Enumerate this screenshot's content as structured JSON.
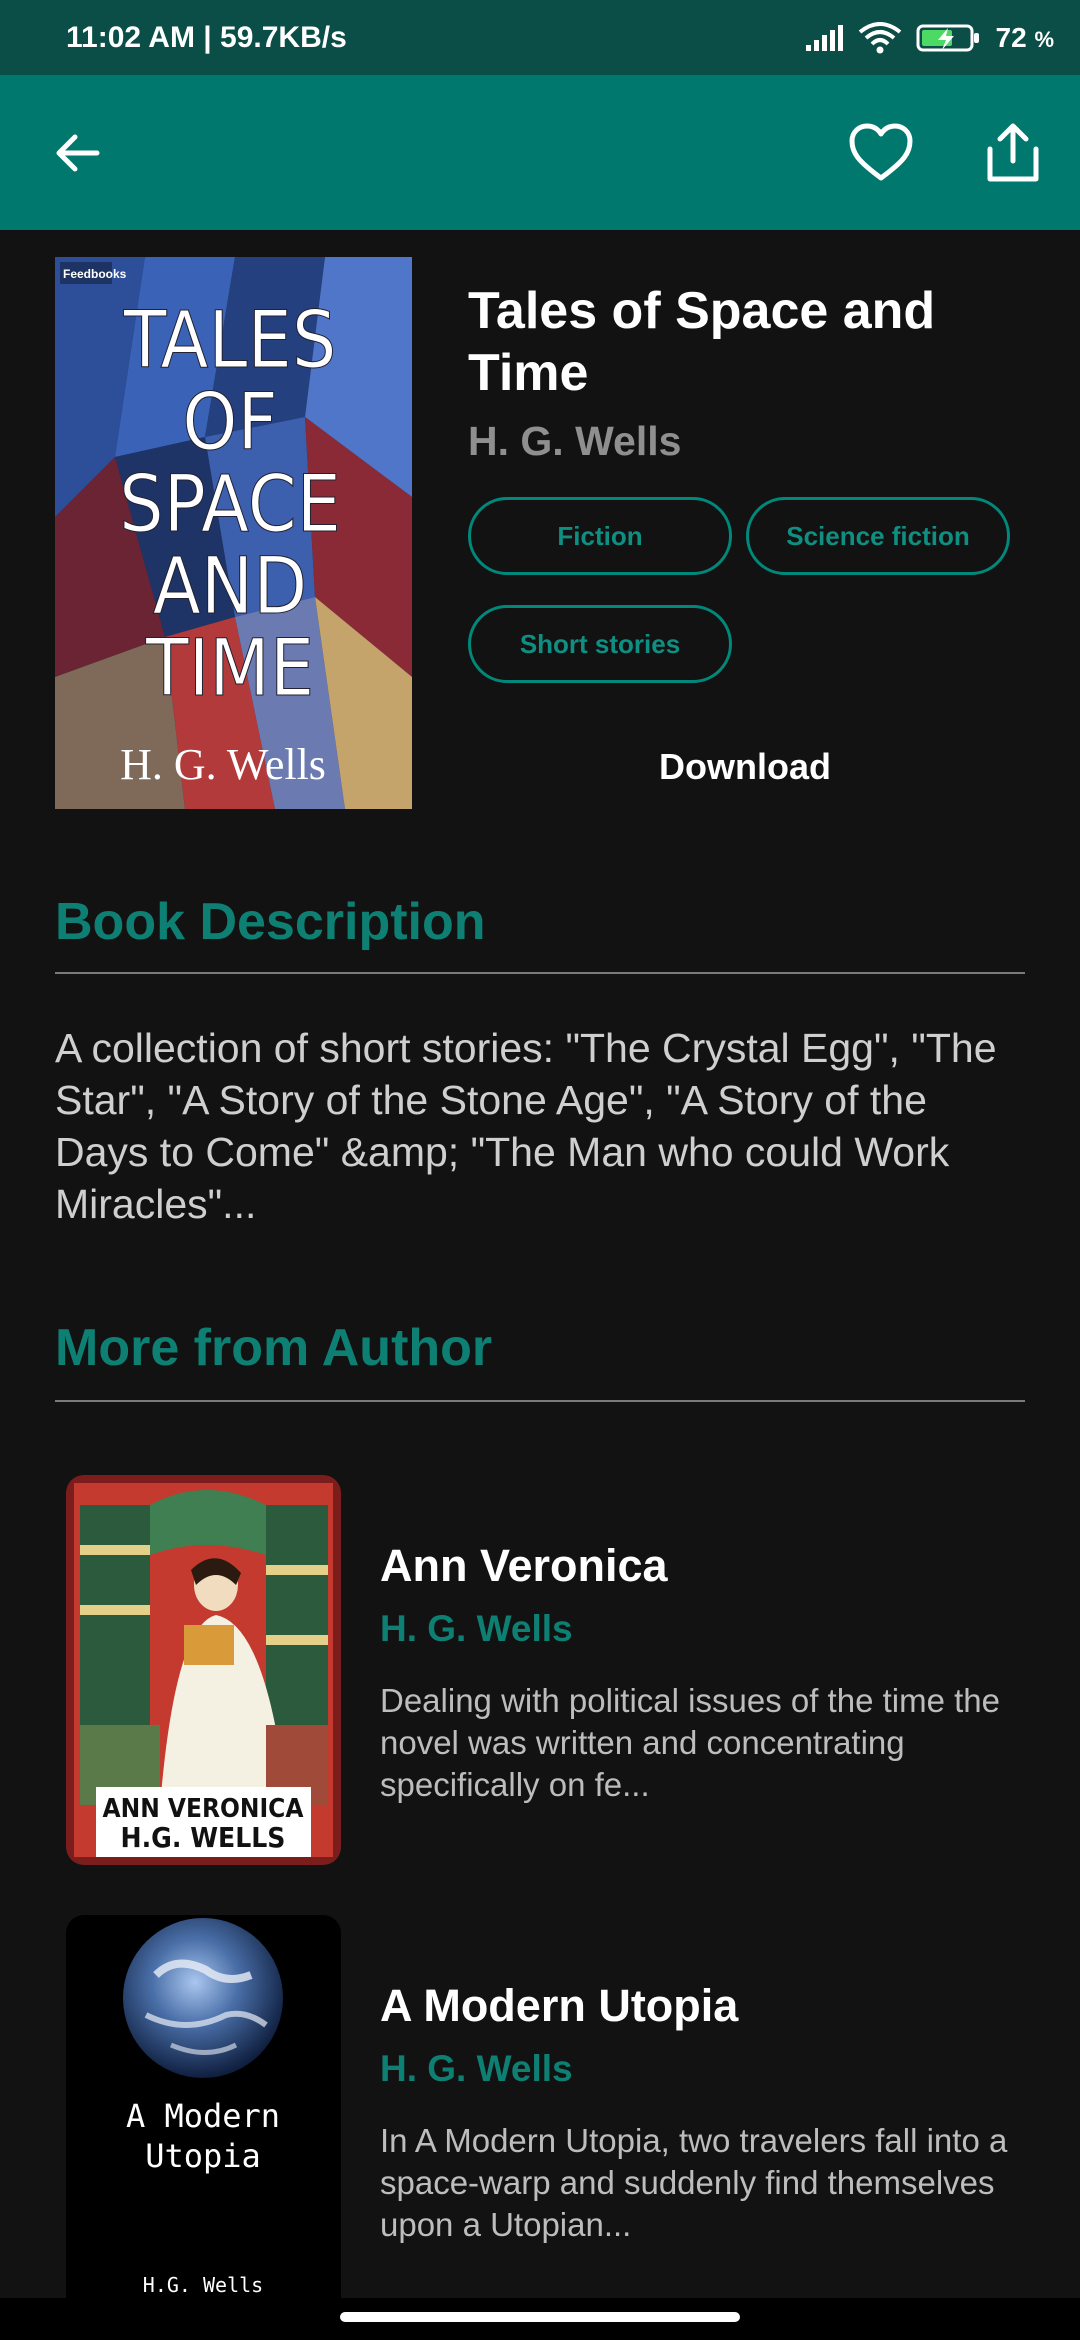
{
  "status_bar": {
    "time": "11:02 AM | 59.7KB/s",
    "battery": "72",
    "battery_unit": "%"
  },
  "app_bar": {
    "back_icon": "arrow-left-icon",
    "favorite_icon": "heart-outline-icon",
    "share_icon": "share-icon"
  },
  "book": {
    "title": "Tales of Space and Time",
    "author": "H. G. Wells",
    "cover_publisher": "Feedbooks",
    "cover_title_lines": [
      "TALES",
      "OF",
      "SPACE",
      "AND",
      "TIME"
    ],
    "cover_author": "H. G. Wells",
    "genres": [
      "Fiction",
      "Science fiction",
      "Short stories"
    ],
    "download_label": "Download"
  },
  "description": {
    "heading": "Book Description",
    "text": "A collection of short stories: \"The Crystal Egg\", \"The Star\", \"A Story of the Stone Age\", \"A Story of the Days to Come\" &amp; \"The Man who could Work Miracles\"..."
  },
  "more_from_author": {
    "heading": "More from Author",
    "books": [
      {
        "title": "Ann Veronica",
        "author": "H. G. Wells",
        "description": "Dealing with political issues of the time the novel was written and concentrating specifically on fe...",
        "cover_line1": "ANN VERONICA",
        "cover_line2": "H.G. WELLS"
      },
      {
        "title": "A Modern Utopia",
        "author": "H. G. Wells",
        "description": "In A Modern Utopia, two travelers fall into a space-warp and suddenly find themselves upon a Utopian...",
        "cover_line1": "A Modern",
        "cover_line2": "Utopia",
        "cover_author": "H.G. Wells"
      }
    ]
  },
  "colors": {
    "status_bar_bg": "#0b4d47",
    "app_bar_bg": "#00786d",
    "accent": "#0e8073",
    "background": "#121212"
  }
}
